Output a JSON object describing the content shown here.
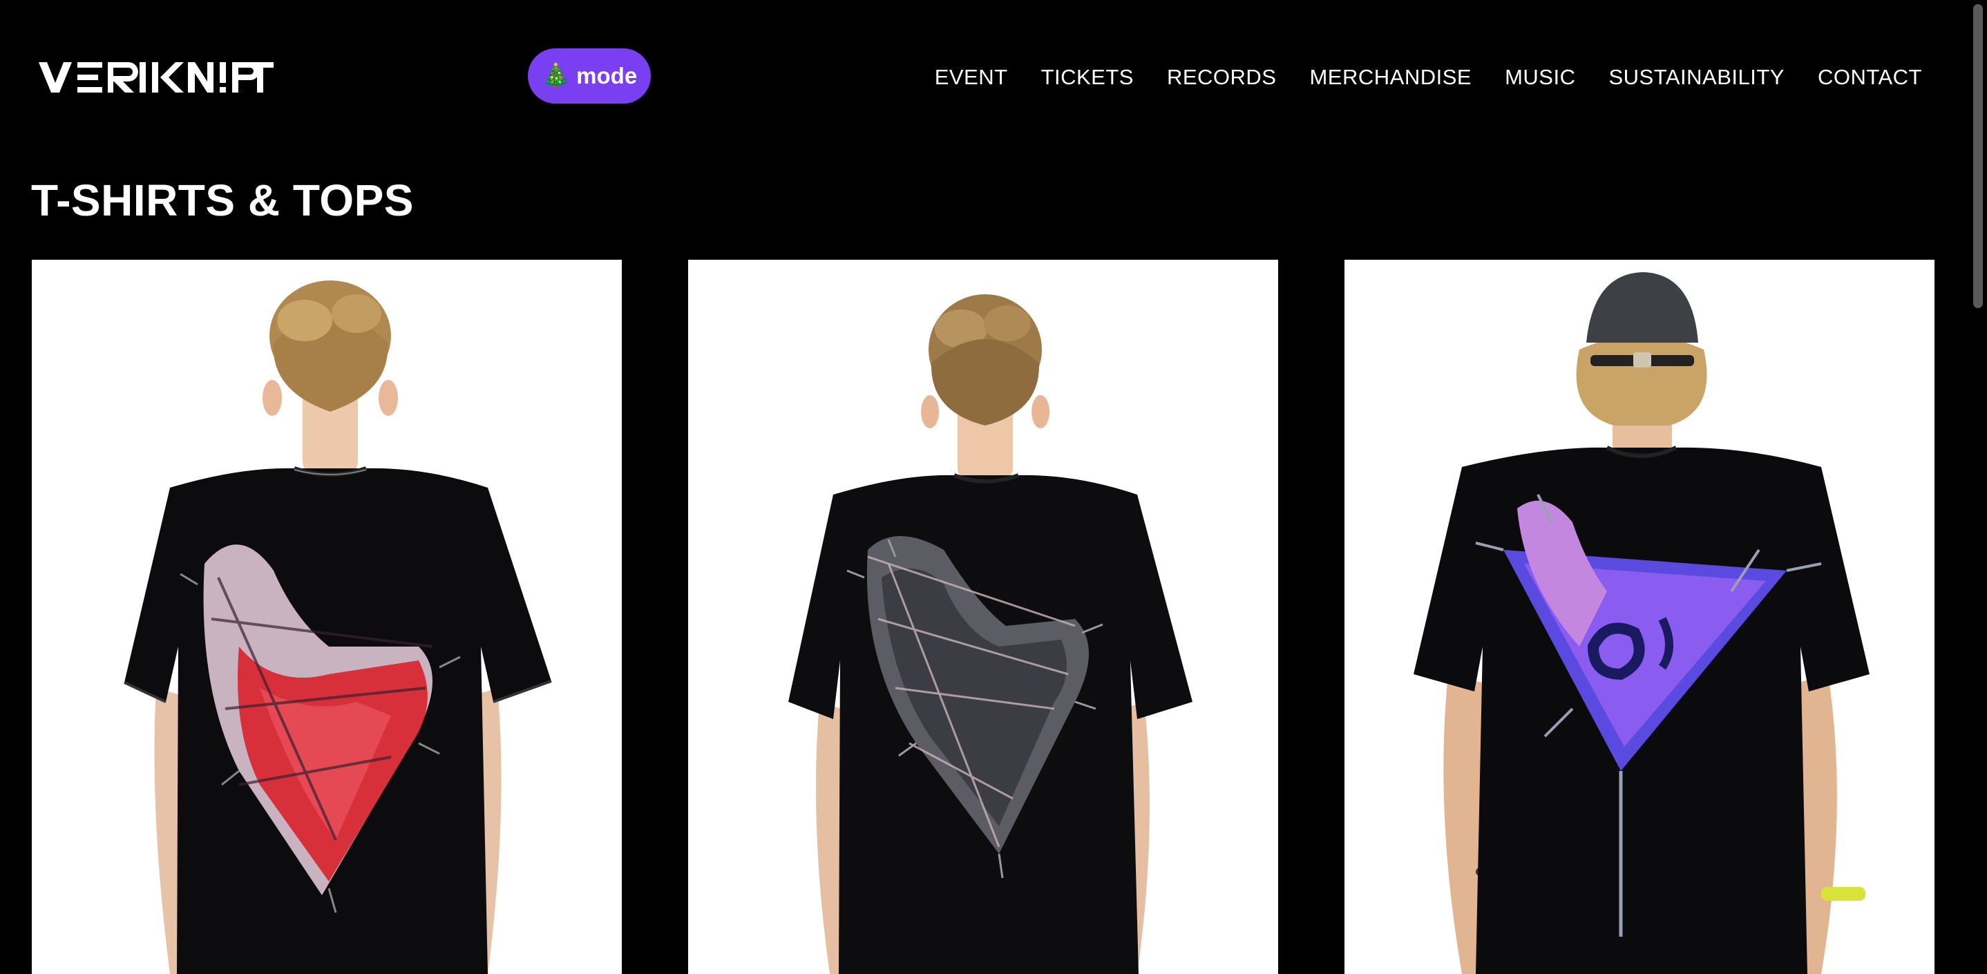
{
  "brand": {
    "logo_text": "VERKNIPT"
  },
  "mode_toggle": {
    "icon": "christmas-tree-icon",
    "label": "mode"
  },
  "nav": {
    "items": [
      {
        "label": "EVENT"
      },
      {
        "label": "TICKETS"
      },
      {
        "label": "RECORDS"
      },
      {
        "label": "MERCHANDISE"
      },
      {
        "label": "MUSIC"
      },
      {
        "label": "SUSTAINABILITY"
      },
      {
        "label": "CONTACT"
      }
    ]
  },
  "section": {
    "title": "T-SHIRTS & TOPS"
  },
  "products": [
    {
      "image": "black-tee-red-thorned-heart-back-print",
      "print_color": "#d8303a"
    },
    {
      "image": "black-tee-grey-barbed-wire-heart-back-print",
      "print_color": "#5c5c64"
    },
    {
      "image": "black-tee-purple-spiked-triangle-back-print",
      "print_color": "#8a5cf0"
    }
  ],
  "colors": {
    "background": "#000000",
    "accent": "#7b3ff2",
    "text": "#ffffff",
    "card_background": "#ffffff"
  }
}
